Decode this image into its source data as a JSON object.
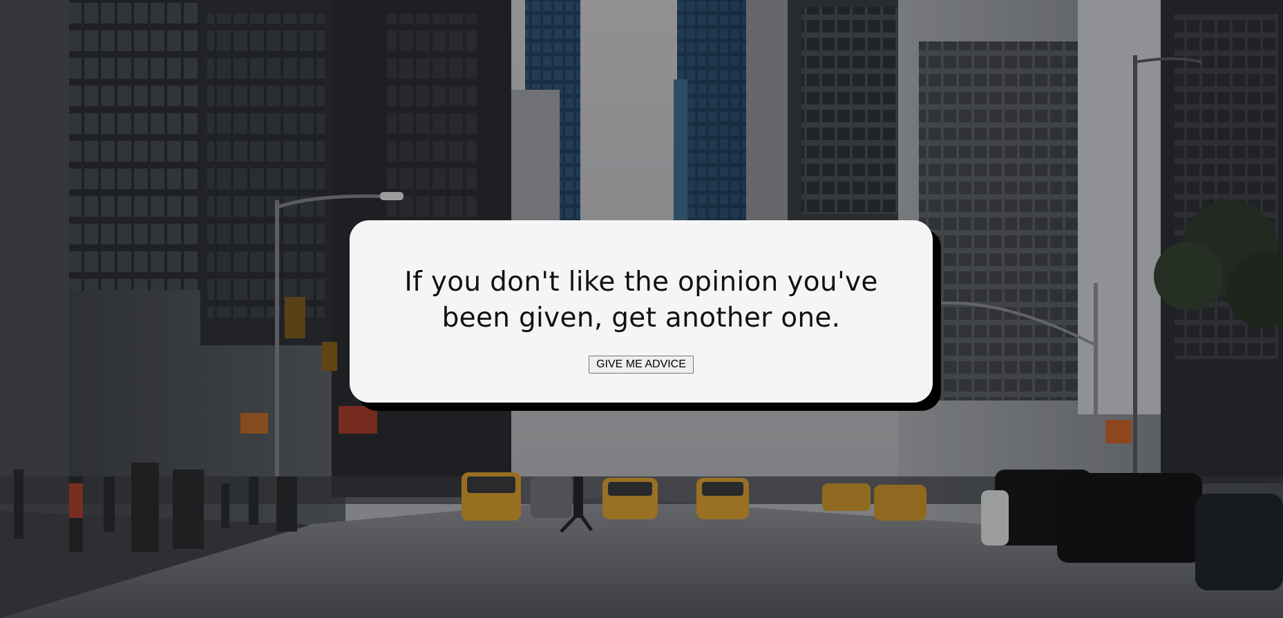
{
  "advice": {
    "text": "If you don't like the opinion you've been given, get another one.",
    "button_label": "GIVE ME ADVICE"
  },
  "colors": {
    "card_background": "#f5f5f5",
    "card_shadow": "#000000",
    "text": "#111111"
  },
  "background": {
    "description_icon": "city-street-photo"
  }
}
